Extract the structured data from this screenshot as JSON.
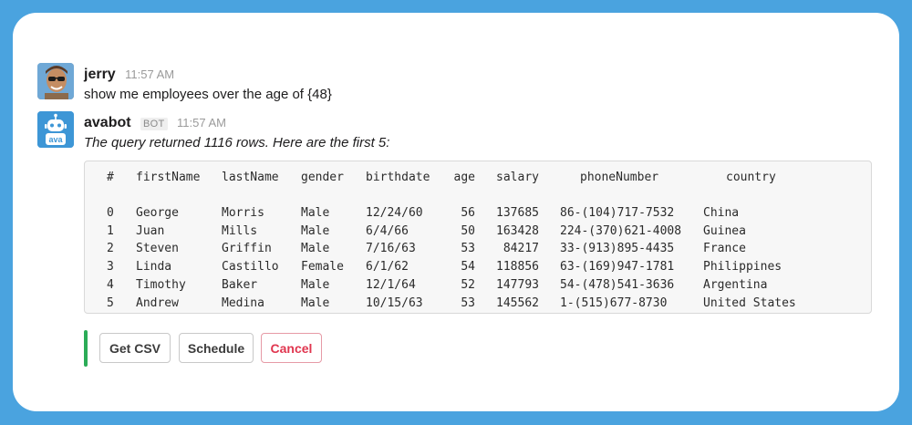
{
  "messages": [
    {
      "author": "jerry",
      "time": "11:57 AM",
      "text": "show me employees over the age of {48}"
    },
    {
      "author": "avabot",
      "badge": "BOT",
      "time": "11:57 AM",
      "text": "The query returned 1116 rows. Here are the first 5:"
    }
  ],
  "table": {
    "headers": [
      "#",
      "firstName",
      "lastName",
      "gender",
      "birthdate",
      "age",
      "salary",
      "phoneNumber",
      "country"
    ],
    "rows": [
      [
        "0",
        "George",
        "Morris",
        "Male",
        "12/24/60",
        "56",
        "137685",
        "86-(104)717-7532",
        "China"
      ],
      [
        "1",
        "Juan",
        "Mills",
        "Male",
        "6/4/66",
        "50",
        "163428",
        "224-(370)621-4008",
        "Guinea"
      ],
      [
        "2",
        "Steven",
        "Griffin",
        "Male",
        "7/16/63",
        "53",
        "84217",
        "33-(913)895-4435",
        "France"
      ],
      [
        "3",
        "Linda",
        "Castillo",
        "Female",
        "6/1/62",
        "54",
        "118856",
        "63-(169)947-1781",
        "Philippines"
      ],
      [
        "4",
        "Timothy",
        "Baker",
        "Male",
        "12/1/64",
        "52",
        "147793",
        "54-(478)541-3636",
        "Argentina"
      ],
      [
        "5",
        "Andrew",
        "Medina",
        "Male",
        "10/15/63",
        "53",
        "145562",
        "1-(515)677-8730",
        "United States"
      ]
    ]
  },
  "actions": {
    "csv_label": "Get CSV",
    "schedule_label": "Schedule",
    "cancel_label": "Cancel"
  },
  "colors": {
    "background": "#4aa3df",
    "accent_bar": "#2bac57",
    "cancel": "#e0364f",
    "bot_avatar": "#3d96d6"
  },
  "icons": {
    "user_avatar": "user-photo-avatar",
    "bot_avatar": "robot-icon",
    "bot_avatar_text": "ava"
  }
}
